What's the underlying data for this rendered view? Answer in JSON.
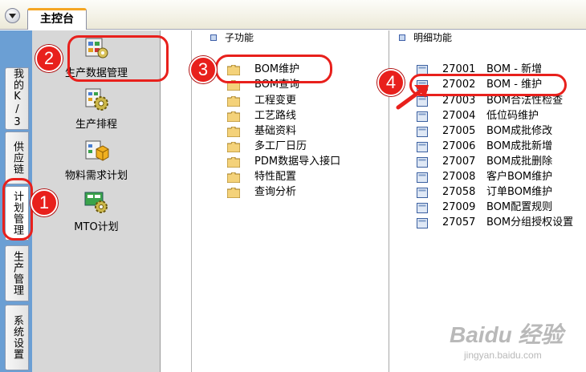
{
  "top_tab": {
    "title": "主控台"
  },
  "side_tabs": [
    {
      "label": "我的K/3"
    },
    {
      "label": "供应链"
    },
    {
      "label": "计划管理"
    },
    {
      "label": "生产管理"
    },
    {
      "label": "系统设置"
    }
  ],
  "categories": [
    {
      "label": "生产数据管理",
      "icon": "data-management-icon"
    },
    {
      "label": "生产排程",
      "icon": "scheduling-gear-icon"
    },
    {
      "label": "物料需求计划",
      "icon": "mrp-cube-icon"
    },
    {
      "label": "MTO计划",
      "icon": "mto-gear-icon"
    }
  ],
  "subfunctions": {
    "header": "子功能",
    "items": [
      "BOM维护",
      "BOM查询",
      "工程变更",
      "工艺路线",
      "基础资料",
      "多工厂日历",
      "PDM数据导入接口",
      "特性配置",
      "查询分析"
    ]
  },
  "details": {
    "header": "明细功能",
    "items": [
      {
        "code": "27001",
        "name": "BOM - 新增"
      },
      {
        "code": "27002",
        "name": "BOM - 维护"
      },
      {
        "code": "27003",
        "name": "BOM合法性检查"
      },
      {
        "code": "27004",
        "name": "低位码维护"
      },
      {
        "code": "27005",
        "name": "BOM成批修改"
      },
      {
        "code": "27006",
        "name": "BOM成批新增"
      },
      {
        "code": "27007",
        "name": "BOM成批删除"
      },
      {
        "code": "27008",
        "name": "客户BOM维护"
      },
      {
        "code": "27058",
        "name": "订单BOM维护"
      },
      {
        "code": "27009",
        "name": "BOM配置规则"
      },
      {
        "code": "27057",
        "name": "BOM分组授权设置"
      }
    ]
  },
  "annotations": [
    "1",
    "2",
    "3",
    "4"
  ],
  "watermark": {
    "main": "Baidu 经验",
    "sub": "jingyan.baidu.com"
  },
  "colors": {
    "annotation_red": "#e8201c",
    "side_bar_blue": "#6b9fd4",
    "category_bg": "#d7d7d7",
    "tab_accent": "#f5a623"
  }
}
